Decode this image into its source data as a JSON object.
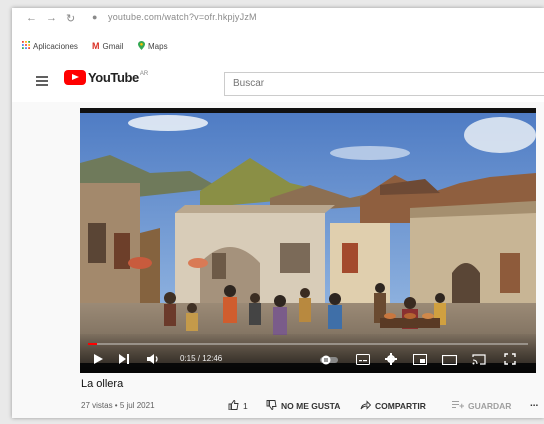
{
  "browser": {
    "url": "youtube.com/watch?v=ofr.hkpjyJzM"
  },
  "bookmarks": [
    {
      "label": "Aplicaciones",
      "icon": "apps-grid-icon"
    },
    {
      "label": "Gmail",
      "icon": "gmail-icon"
    },
    {
      "label": "Maps",
      "icon": "maps-pin-icon"
    }
  ],
  "header": {
    "logo_text": "YouTube",
    "logo_region": "AR",
    "search_placeholder": "Buscar"
  },
  "player": {
    "time": "0:15 / 12:46",
    "progress": 0.02
  },
  "video": {
    "title": "La ollera",
    "meta": "27 vistas • 5 jul 2021"
  },
  "actions": {
    "like_count": "1",
    "dislike_label": "NO ME GUSTA",
    "share_label": "COMPARTIR",
    "save_label": "GUARDAR",
    "more_label": "..."
  },
  "colors": {
    "brand_red": "#ff0000",
    "progress_red": "#ff0000"
  }
}
